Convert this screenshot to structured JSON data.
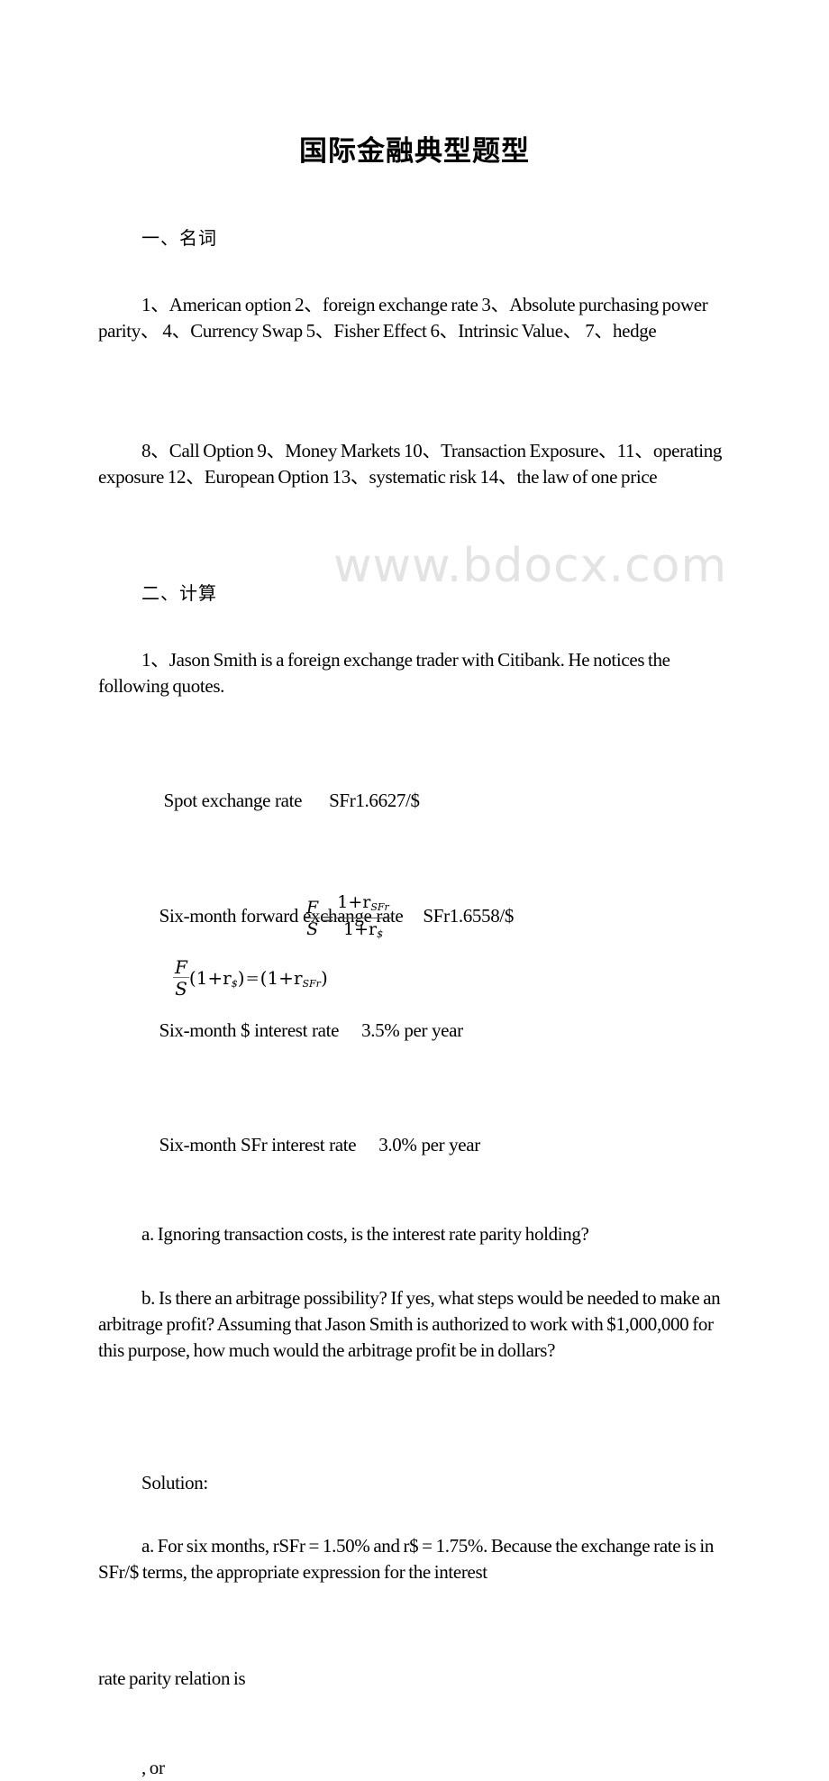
{
  "document": {
    "title": "国际金融典型题型",
    "watermark": "www.bdocx.com",
    "section1": {
      "heading": "一、名词",
      "terms_para1": "1、American option 2、foreign exchange rate 3、Absolute purchasing power parity、 4、Currency Swap 5、Fisher Effect 6、Intrinsic Value、 7、hedge",
      "terms_para2": "8、Call Option 9、Money Markets 10、Transaction Exposure、11、operating exposure 12、European Option 13、systematic risk 14、the law of one price"
    },
    "section2": {
      "heading": "二、计算",
      "problem1_intro": "1、Jason Smith is a foreign exchange trader with Citibank. He notices the following quotes.",
      "quotes": [
        {
          "label": "Spot exchange rate",
          "value": "SFr1.6627/$"
        },
        {
          "label": "Six-month forward exchange rate",
          "value": "SFr1.6558/$"
        },
        {
          "label": "Six-month $ interest rate",
          "value": "3.5% per year"
        },
        {
          "label": "Six-month SFr interest rate",
          "value": "3.0% per year"
        }
      ],
      "question_a": "a. Ignoring transaction costs, is the interest rate parity holding?",
      "question_b": "b. Is there an arbitrage possibility? If yes, what steps would be needed to make an arbitrage profit? Assuming that Jason Smith is authorized to work with $1,000,000 for this purpose, how much would the arbitrage profit be in dollars?",
      "solution_label": "Solution:",
      "solution_a": "a.  For six months, rSFr = 1.50% and r$ = 1.75%. Because the exchange rate is in SFr/$ terms, the appropriate expression for the interest",
      "solution_a_cont": "rate parity relation is",
      "or_text": ", or",
      "formula1": {
        "lhs_num": "F",
        "lhs_den": "S",
        "equals": "=",
        "rhs_num": "1+r",
        "rhs_num_sub": "SFr",
        "rhs_den": "1+r",
        "rhs_den_sub": "$"
      },
      "formula2": {
        "frac_num": "F",
        "frac_den": "S",
        "left_paren": "(1+r",
        "left_sub": "$",
        "close": ")",
        "equals": "=",
        "right_paren": "(1+r",
        "right_sub": "SFr"
      }
    }
  }
}
